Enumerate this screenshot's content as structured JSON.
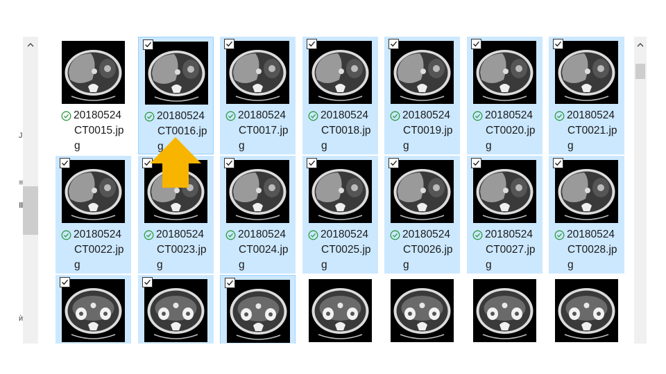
{
  "window": {
    "title": ""
  },
  "files": [
    {
      "line1": "20180524",
      "line2": "CT0015.jp",
      "line3": "g",
      "selected": false,
      "checked": false,
      "synced": true,
      "scan": "liver-spleen"
    },
    {
      "line1": "20180524",
      "line2": "CT0016.jp",
      "line3": "g",
      "selected": true,
      "checked": true,
      "synced": true,
      "focused": true,
      "scan": "liver-spleen"
    },
    {
      "line1": "20180524",
      "line2": "CT0017.jp",
      "line3": "g",
      "selected": true,
      "checked": true,
      "synced": true,
      "scan": "liver-spleen"
    },
    {
      "line1": "20180524",
      "line2": "CT0018.jp",
      "line3": "g",
      "selected": true,
      "checked": true,
      "synced": true,
      "scan": "liver-spleen"
    },
    {
      "line1": "20180524",
      "line2": "CT0019.jp",
      "line3": "g",
      "selected": true,
      "checked": true,
      "synced": true,
      "scan": "liver-spleen"
    },
    {
      "line1": "20180524",
      "line2": "CT0020.jp",
      "line3": "g",
      "selected": true,
      "checked": true,
      "synced": true,
      "scan": "liver-spleen"
    },
    {
      "line1": "20180524",
      "line2": "CT0021.jp",
      "line3": "g",
      "selected": true,
      "checked": true,
      "synced": true,
      "scan": "liver-spleen"
    },
    {
      "line1": "20180524",
      "line2": "CT0022.jp",
      "line3": "g",
      "selected": true,
      "checked": true,
      "synced": true,
      "scan": "liver-spleen"
    },
    {
      "line1": "20180524",
      "line2": "CT0023.jp",
      "line3": "g",
      "selected": true,
      "checked": true,
      "synced": true,
      "scan": "liver-spleen"
    },
    {
      "line1": "20180524",
      "line2": "CT0024.jp",
      "line3": "g",
      "selected": true,
      "checked": true,
      "synced": true,
      "scan": "liver-spleen"
    },
    {
      "line1": "20180524",
      "line2": "CT0025.jp",
      "line3": "g",
      "selected": true,
      "checked": true,
      "synced": true,
      "scan": "liver-spleen"
    },
    {
      "line1": "20180524",
      "line2": "CT0026.jp",
      "line3": "g",
      "selected": true,
      "checked": true,
      "synced": true,
      "scan": "liver-spleen"
    },
    {
      "line1": "20180524",
      "line2": "CT0027.jp",
      "line3": "g",
      "selected": true,
      "checked": true,
      "synced": true,
      "scan": "liver-spleen"
    },
    {
      "line1": "20180524",
      "line2": "CT0028.jp",
      "line3": "g",
      "selected": true,
      "checked": true,
      "synced": true,
      "scan": "liver-spleen"
    },
    {
      "line1": "",
      "line2": "",
      "line3": "",
      "selected": true,
      "checked": true,
      "synced": false,
      "scan": "kidneys"
    },
    {
      "line1": "",
      "line2": "",
      "line3": "",
      "selected": true,
      "checked": true,
      "synced": false,
      "scan": "kidneys"
    },
    {
      "line1": "",
      "line2": "",
      "line3": "",
      "selected": true,
      "checked": true,
      "synced": false,
      "focused": true,
      "scan": "kidneys"
    },
    {
      "line1": "",
      "line2": "",
      "line3": "",
      "selected": false,
      "checked": false,
      "synced": false,
      "scan": "kidneys"
    },
    {
      "line1": "",
      "line2": "",
      "line3": "",
      "selected": false,
      "checked": false,
      "synced": false,
      "scan": "kidneys"
    },
    {
      "line1": "",
      "line2": "",
      "line3": "",
      "selected": false,
      "checked": false,
      "synced": false,
      "scan": "kidneys"
    },
    {
      "line1": "",
      "line2": "",
      "line3": "",
      "selected": false,
      "checked": false,
      "synced": false,
      "scan": "kidneys"
    }
  ],
  "icons": {
    "status": "sync-ok-icon",
    "checkbox": "checkbox-checked-icon",
    "scroll_up": "chevron-up-icon",
    "pointer": "arrow-up-icon"
  },
  "left_pane_glyphs": [
    "J",
    "≡",
    "Ⅲ",
    "ѝ"
  ],
  "colors": {
    "selection": "#cce8ff",
    "focus_border": "#99d1ff",
    "sync_ok": "#2d9b3e",
    "arrow": "#f7b500"
  }
}
